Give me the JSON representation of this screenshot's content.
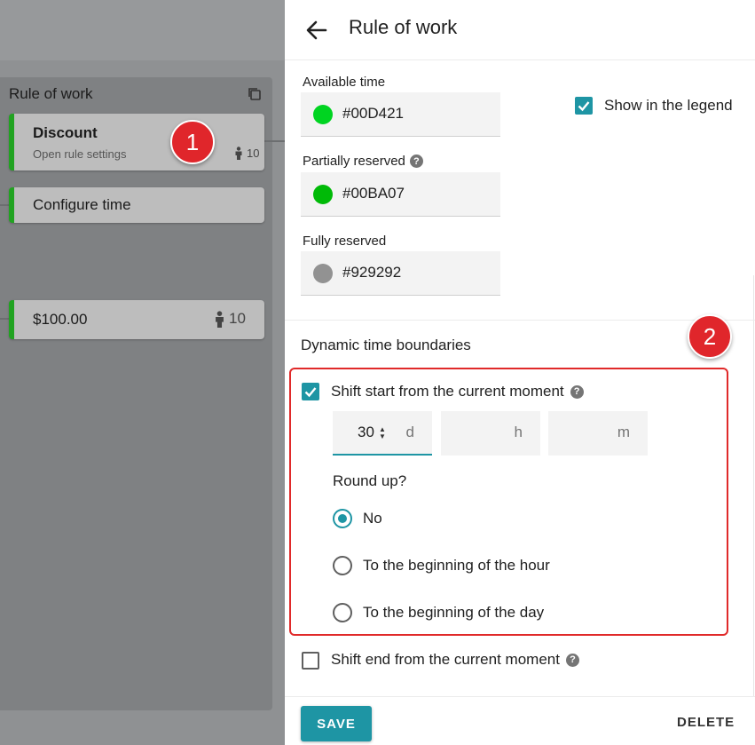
{
  "sidebar": {
    "title": "Rule of work",
    "cards": [
      {
        "title": "Discount",
        "subtitle": "Open rule settings",
        "count": "10"
      },
      {
        "title": "Configure time"
      },
      {
        "title": "$100.00",
        "count": "10"
      }
    ]
  },
  "annotations": {
    "badge1": "1",
    "badge2": "2"
  },
  "header": {
    "title": "Rule of work"
  },
  "colors_section": {
    "available": {
      "label": "Available time",
      "value": "#00D421",
      "color": "#00D421"
    },
    "partial": {
      "label": "Partially reserved",
      "value": "#00BA07",
      "color": "#00BA07"
    },
    "full": {
      "label": "Fully reserved",
      "value": "#929292",
      "color": "#929292"
    },
    "legend_label": "Show in the legend"
  },
  "dynamic": {
    "title": "Dynamic time boundaries",
    "shift_start_label": "Shift start from the current moment",
    "days_value": "30",
    "days_unit": "d",
    "hours_unit": "h",
    "minutes_unit": "m",
    "round_up_label": "Round up?",
    "options": [
      "No",
      "To the beginning of the hour",
      "To the beginning of the day"
    ],
    "shift_end_label": "Shift end from the current moment"
  },
  "footer": {
    "save_label": "SAVE",
    "delete_label": "DELETE"
  },
  "theme": {
    "accent": "#1e95a4",
    "card_stripe": "#21a321",
    "badge": "#e0262b"
  }
}
